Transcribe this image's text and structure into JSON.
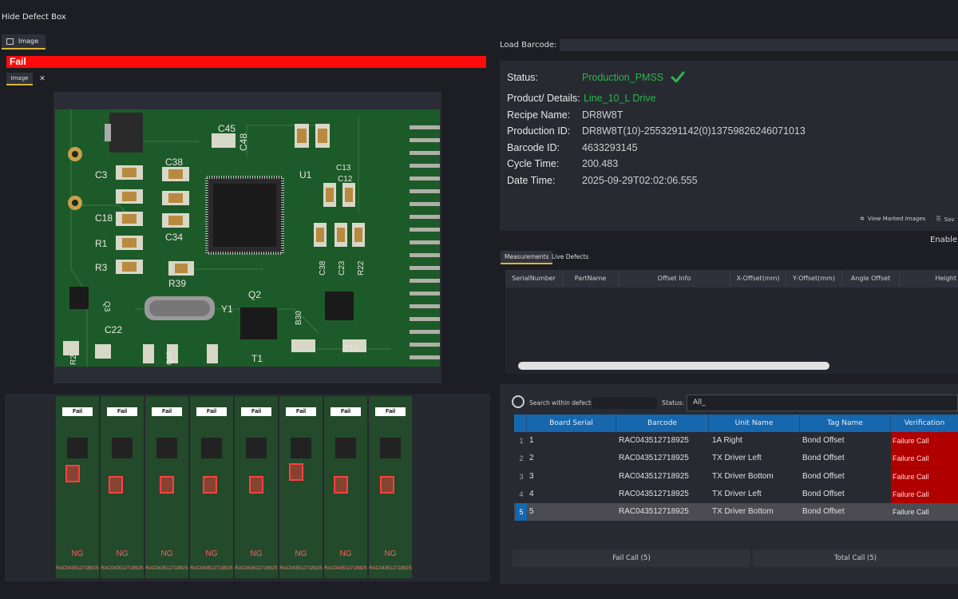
{
  "toolbar": {
    "hide_defect_box": "Hide Defect Box"
  },
  "left": {
    "image_tab": "Image",
    "result_banner": "Fail",
    "subtab": "Image",
    "close": "✕",
    "pcb_labels": [
      "C45",
      "C48",
      "U1",
      "C3",
      "C38",
      "C13",
      "C12",
      "C18",
      "C34",
      "R1",
      "R3",
      "R39",
      "Y1",
      "Q2",
      "C22",
      "T1",
      "C38",
      "C23",
      "R22",
      "B30",
      "B10",
      "R2",
      "Q3",
      "Q18"
    ],
    "strips": [
      {
        "label": "Fail",
        "ng": "NG",
        "code": "RAC04351271892S"
      },
      {
        "label": "Fail",
        "ng": "NG",
        "code": "RAC04351271892S"
      },
      {
        "label": "Fail",
        "ng": "NG",
        "code": "RAC04351271892S"
      },
      {
        "label": "Fail",
        "ng": "NG",
        "code": "RAC04351271892S"
      },
      {
        "label": "Fail",
        "ng": "NG",
        "code": "RAC04351271892S"
      },
      {
        "label": "Fail",
        "ng": "NG",
        "code": "RAC04351271892S"
      },
      {
        "label": "Fail",
        "ng": "NG",
        "code": "RAC04351271892S"
      },
      {
        "label": "Fail",
        "ng": "NG",
        "code": "RAC04351271892S"
      }
    ]
  },
  "barcode": {
    "label": "Load Barcode:",
    "value": ""
  },
  "details": {
    "status_label": "Status:",
    "status_value": "Production_PMSS",
    "product_label": "Product/ Details:",
    "product_value": "Line_10_L Drive",
    "recipe_label": "Recipe Name:",
    "recipe_value": "DR8W8T",
    "production_label": "Production ID:",
    "production_value": "DR8W8T(10)-2553291142(0)13759826246071013",
    "barcode_label": "Barcode ID:",
    "barcode_value": "4633293145",
    "cycle_label": "Cycle Time:",
    "cycle_value": "200.483",
    "date_label": "Date Time:",
    "date_value": "2025-09-29T02:02:06.555",
    "view_marked": "View Marked Images",
    "save": "Sav",
    "enable": "Enable"
  },
  "tabs": {
    "measurements": "Measurements",
    "live_defects": "Live Defects"
  },
  "measure_headers": [
    "SerialNumber",
    "PartName",
    "Offset Info",
    "X-Offset(mm)",
    "Y-Offset(mm)",
    "Angle Offset",
    "Height"
  ],
  "defects": {
    "search_label": "Search within defects",
    "status_label": "Status:",
    "status_value": "All_",
    "headers": [
      "Board Serial",
      "Barcode",
      "Unit Name",
      "Tag Name",
      "Verification"
    ],
    "rows": [
      {
        "idx": "1",
        "serial": "1",
        "barcode": "RAC043512718925",
        "unit": "1A Right",
        "tag": "Bond  Offset",
        "verification": "Failure Call"
      },
      {
        "idx": "2",
        "serial": "2",
        "barcode": "RAC043512718925",
        "unit": "TX Driver Left",
        "tag": "Bond  Offset",
        "verification": "Failure Call"
      },
      {
        "idx": "3",
        "serial": "3",
        "barcode": "RAC043512718925",
        "unit": "TX Driver Bottom",
        "tag": "Bond  Offset",
        "verification": "Failure Call"
      },
      {
        "idx": "4",
        "serial": "4",
        "barcode": "RAC043512718925",
        "unit": "TX Driver Left",
        "tag": "Bond  Offset",
        "verification": "Failure Call"
      },
      {
        "idx": "5",
        "serial": "5",
        "barcode": "RAC043512718925",
        "unit": "TX Driver Bottom",
        "tag": "Bond  Offset",
        "verification": "Failure Call"
      }
    ],
    "fail_call": "Fail Call (5)",
    "total_call": "Total Call (5)"
  },
  "colors": {
    "fail_red": "#ff0a0a",
    "status_green": "#2fb44b",
    "header_blue": "#1667ad",
    "accent_gold": "#d8b43c"
  }
}
